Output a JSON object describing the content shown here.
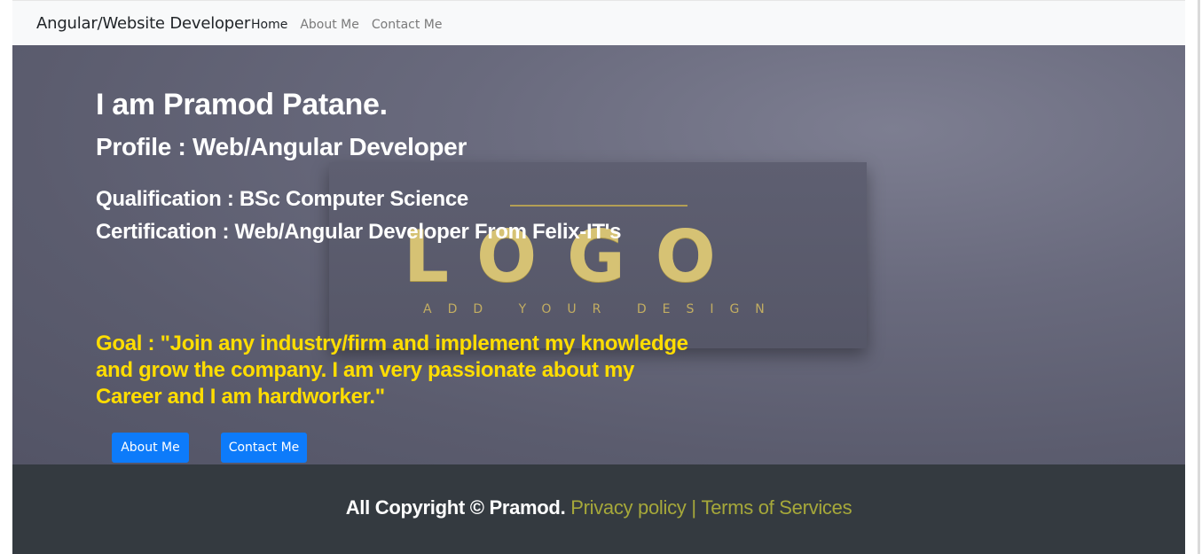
{
  "navbar": {
    "brand": "Angular/Website Developer",
    "links": [
      {
        "label": "Home",
        "active": true
      },
      {
        "label": "About Me",
        "active": false
      },
      {
        "label": "Contact Me",
        "active": false
      }
    ]
  },
  "hero": {
    "name": "I am Pramod Patane.",
    "profile": "Profile : Web/Angular Developer",
    "qualification": "Qualification : BSc Computer Science",
    "certification": "Certification : Web/Angular Developer From Felix-IT's",
    "goal": "Goal : \"Join any industry/firm and implement my knowledge and grow the company. I am very passionate about my Career and I am hardworker.\"",
    "buttons": {
      "about": "About Me",
      "contact": "Contact Me"
    },
    "background_card": {
      "logo": "LOGO",
      "tagline": "ADD YOUR DESIGN"
    }
  },
  "footer": {
    "copyright": "All Copyright © Pramod.",
    "privacy": "Privacy policy",
    "separator": "|",
    "terms": "Terms of Services"
  },
  "colors": {
    "navbar_bg": "#f8f9fa",
    "footer_bg": "#343a40",
    "button_bg": "#0d7bfa",
    "goal_text": "#ffdd00",
    "footer_link": "#a6a83a"
  }
}
